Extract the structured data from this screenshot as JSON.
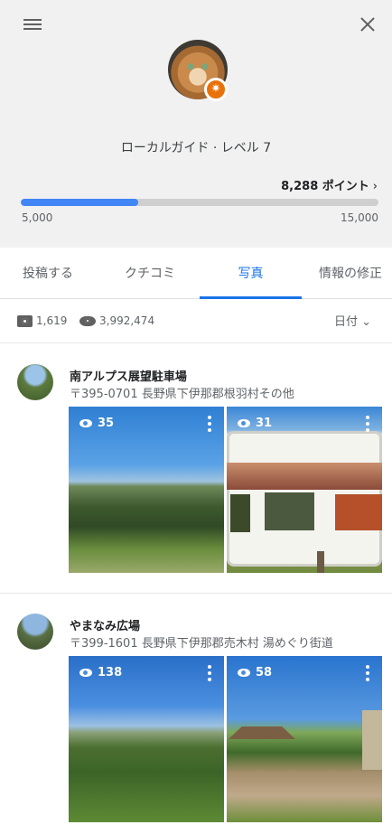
{
  "profile": {
    "guide_level": "ローカルガイド · レベル 7",
    "points": "8,288 ポイント",
    "points_chevron": "›",
    "progress": {
      "min_label": "5,000",
      "max_label": "15,000",
      "current": 8288,
      "min": 5000,
      "max": 15000
    },
    "badge_glyph": "✷"
  },
  "tabs": [
    {
      "label": "投稿する"
    },
    {
      "label": "クチコミ"
    },
    {
      "label": "写真",
      "active": true
    },
    {
      "label": "情報の修正"
    }
  ],
  "stats": {
    "photo_count": "1,619",
    "view_count": "3,992,474",
    "sort_label": "日付",
    "sort_chevron": "⌄"
  },
  "places": [
    {
      "name": "南アルプス展望駐車場",
      "address": "〒395-0701 長野県下伊那郡根羽村その他",
      "photos": [
        {
          "views": "35"
        },
        {
          "views": "31"
        }
      ]
    },
    {
      "name": "やまなみ広場",
      "address": "〒399-1601 長野県下伊那郡売木村 湯めぐり街道",
      "photos": [
        {
          "views": "138"
        },
        {
          "views": "58"
        }
      ]
    }
  ],
  "colors": {
    "accent": "#1a73e8",
    "progress_fill": "#4285f4",
    "badge": "#e8710a",
    "header_bg": "#f1f1f1"
  }
}
